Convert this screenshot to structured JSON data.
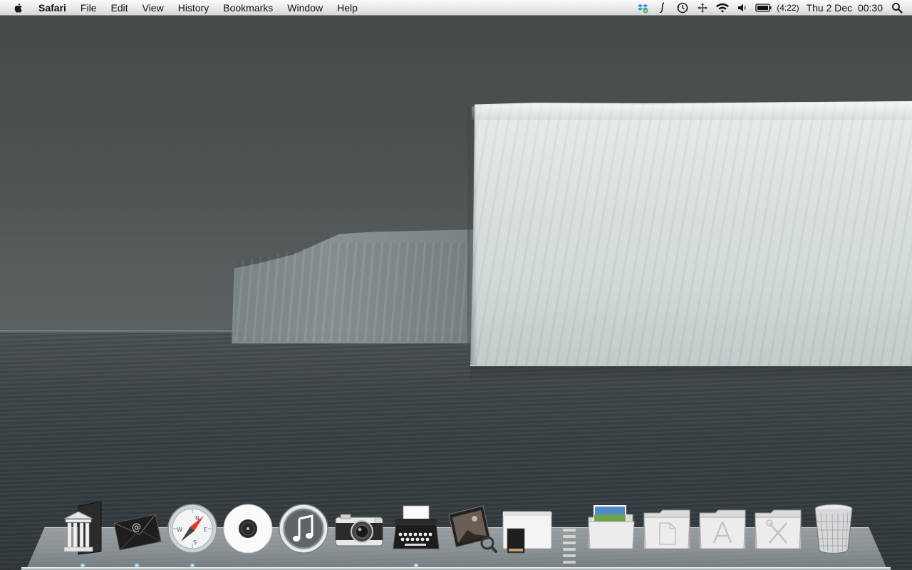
{
  "menubar": {
    "app_name": "Safari",
    "menus": [
      "File",
      "Edit",
      "View",
      "History",
      "Bookmarks",
      "Window",
      "Help"
    ],
    "status": {
      "battery_time": "(4:22)",
      "clock": "Thu 2 Dec  00:30"
    }
  },
  "dock": {
    "apps": [
      {
        "icon": "library-door-icon",
        "running": true
      },
      {
        "icon": "mail-envelope-icon",
        "running": true
      },
      {
        "icon": "safari-compass-icon",
        "running": true
      },
      {
        "icon": "dvd-player-disc-icon",
        "running": false
      },
      {
        "icon": "itunes-icon",
        "running": false
      },
      {
        "icon": "camera-icon",
        "running": false
      },
      {
        "icon": "typewriter-icon",
        "running": true
      },
      {
        "icon": "photo-viewer-icon",
        "running": false
      },
      {
        "icon": "drive-icon",
        "running": false
      }
    ],
    "folders": [
      {
        "icon": "pictures-folder-icon"
      },
      {
        "icon": "documents-folder-icon"
      },
      {
        "icon": "applications-folder-icon"
      },
      {
        "icon": "utilities-folder-icon"
      }
    ],
    "trash": {
      "icon": "trash-icon"
    }
  }
}
